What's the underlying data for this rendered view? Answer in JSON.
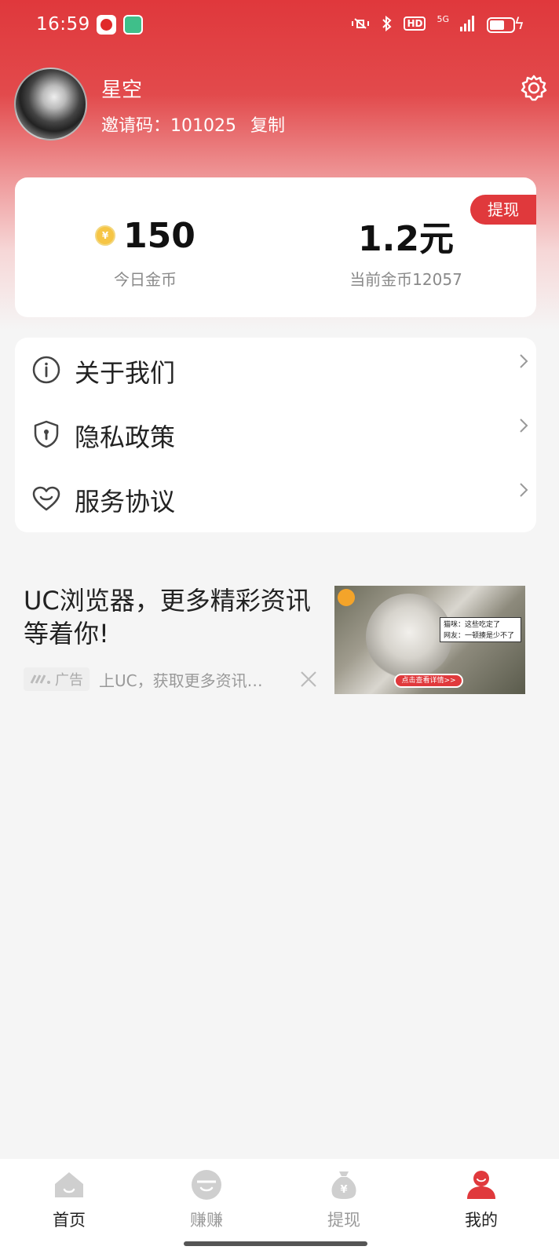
{
  "status_bar": {
    "time": "16:59",
    "network": "5G"
  },
  "profile": {
    "nickname": "星空",
    "invite_label": "邀请码：101025",
    "copy_label": "复制"
  },
  "balance_card": {
    "withdraw_tag": "提现",
    "today_coins_value": "150",
    "today_coins_label": "今日金币",
    "cash_value": "1.2元",
    "current_coins_label": "当前金币12057",
    "coin_icon": "coin-icon"
  },
  "menu": {
    "items": [
      {
        "label": "关于我们",
        "icon": "info-icon"
      },
      {
        "label": "隐私政策",
        "icon": "shield-icon"
      },
      {
        "label": "服务协议",
        "icon": "heart-icon"
      }
    ]
  },
  "ad": {
    "title": "UC浏览器，更多精彩资讯等着你!",
    "badge": "广告",
    "description": "上UC，获取更多资讯…",
    "image_caption_line1": "猫咪：这些吃定了",
    "image_caption_line2": "网友：一顿揍是少不了",
    "image_cta": "点击查看详情>>"
  },
  "tabbar": {
    "tabs": [
      {
        "label": "首页",
        "icon": "home-icon"
      },
      {
        "label": "赚赚",
        "icon": "earn-icon"
      },
      {
        "label": "提现",
        "icon": "money-bag-icon"
      },
      {
        "label": "我的",
        "icon": "user-icon"
      }
    ],
    "active_index": 3
  },
  "colors": {
    "brand_red": "#e0393c",
    "inactive_gray": "#999999"
  }
}
